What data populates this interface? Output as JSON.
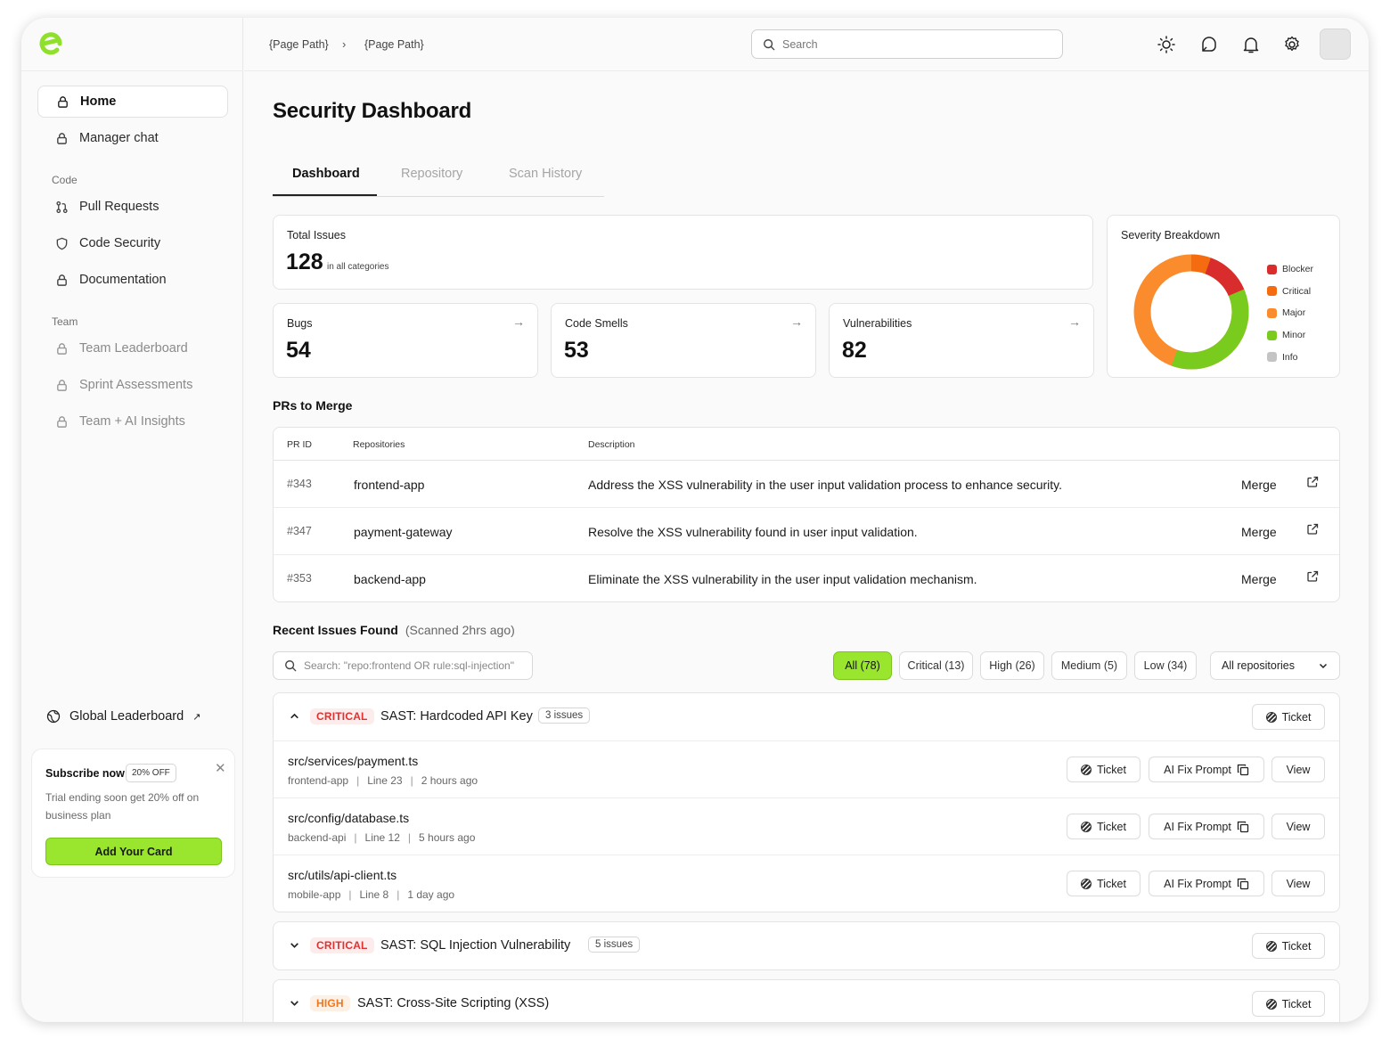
{
  "sidebar": {
    "nav": [
      {
        "label": "Home"
      },
      {
        "label": "Manager chat"
      }
    ],
    "code_section": "Code",
    "code_items": [
      {
        "label": "Pull Requests"
      },
      {
        "label": "Code Security"
      },
      {
        "label": "Documentation"
      }
    ],
    "team_section": "Team",
    "team_items": [
      {
        "label": "Team Leaderboard"
      },
      {
        "label": "Sprint Assessments"
      },
      {
        "label": "Team + AI Insights"
      }
    ],
    "global_leaderboard": "Global Leaderboard",
    "promo": {
      "title": "Subscribe now",
      "badge": "20% OFF",
      "text": "Trial ending soon get 20% off on business plan",
      "button": "Add Your Card"
    }
  },
  "topbar": {
    "breadcrumb": [
      "{Page Path}",
      "{Page Path}"
    ],
    "search_placeholder": "Search"
  },
  "page": {
    "title": "Security Dashboard",
    "tabs": [
      "Dashboard",
      "Repository",
      "Scan History"
    ]
  },
  "stats": {
    "total_label": "Total Issues",
    "total_value": "128",
    "total_sub": "in all categories",
    "cards": [
      {
        "label": "Bugs",
        "value": "54"
      },
      {
        "label": "Code Smells",
        "value": "53"
      },
      {
        "label": "Vulnerabilities",
        "value": "82"
      }
    ]
  },
  "severity": {
    "title": "Severity Breakdown",
    "legend": [
      {
        "label": "Blocker",
        "color": "#d92c2c"
      },
      {
        "label": "Critical",
        "color": "#f56b0f"
      },
      {
        "label": "Major",
        "color": "#fb8c2d"
      },
      {
        "label": "Minor",
        "color": "#79cb1d"
      },
      {
        "label": "Info",
        "color": "#c4c4c4"
      }
    ]
  },
  "prs": {
    "title": "PRs to Merge",
    "columns": [
      "PR ID",
      "Repositories",
      "Description"
    ],
    "rows": [
      {
        "id": "#343",
        "repo": "frontend-app",
        "desc": "Address the XSS vulnerability in the user input validation process to enhance security.",
        "action": "Merge"
      },
      {
        "id": "#347",
        "repo": "payment-gateway",
        "desc": "Resolve the XSS vulnerability found in user input validation.",
        "action": "Merge"
      },
      {
        "id": "#353",
        "repo": "backend-app",
        "desc": "Eliminate the XSS vulnerability in the user input validation mechanism.",
        "action": "Merge"
      }
    ]
  },
  "issues": {
    "title": "Recent Issues Found",
    "scanned": "(Scanned 2hrs ago)",
    "search_placeholder": "Search: \"repo:frontend OR rule:sql-injection\"",
    "filters": [
      "All (78)",
      "Critical (13)",
      "High (26)",
      "Medium (5)",
      "Low (34)"
    ],
    "repo_filter": "All repositories",
    "ticket": "Ticket",
    "ai_fix": "AI Fix Prompt",
    "view": "View",
    "groups": [
      {
        "severity": "CRITICAL",
        "title": "SAST: Hardcoded API Key",
        "count": "3 issues",
        "files": [
          {
            "path": "src/services/payment.ts",
            "repo": "frontend-app",
            "line": "Line 23",
            "time": "2 hours ago"
          },
          {
            "path": "src/config/database.ts",
            "repo": "backend-api",
            "line": "Line 12",
            "time": "5 hours ago"
          },
          {
            "path": "src/utils/api-client.ts",
            "repo": "mobile-app",
            "line": "Line 8",
            "time": "1 day ago"
          }
        ]
      },
      {
        "severity": "CRITICAL",
        "title": "SAST: SQL Injection Vulnerability",
        "count": "5 issues"
      },
      {
        "severity": "HIGH",
        "title": "SAST: Cross-Site Scripting (XSS)"
      }
    ]
  },
  "colors": {
    "accent": "#9ae62f",
    "critical": "#e03131",
    "high": "#f2761b"
  }
}
